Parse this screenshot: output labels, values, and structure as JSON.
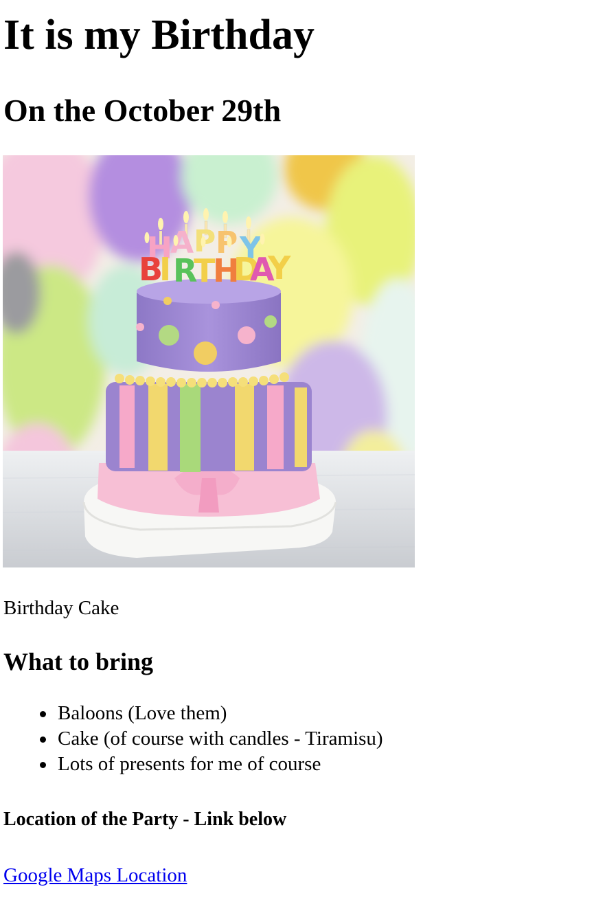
{
  "page": {
    "title": "It is my Birthday",
    "subtitle": "On the October 29th",
    "image": {
      "icon": "birthday-cake-icon",
      "candle_letters_top": [
        "H",
        "A",
        "P",
        "P",
        "Y"
      ],
      "candle_letters_bottom": [
        "B",
        "I",
        "R",
        "T",
        "H",
        "D",
        "A",
        "Y"
      ]
    },
    "caption": "Birthday Cake",
    "bring_heading": "What to bring",
    "bring_items": [
      "Baloons (Love them)",
      "Cake (of course with candles - Tiramisu)",
      "Lots of presents for me of course"
    ],
    "location_heading": "Location of the Party - Link below",
    "maps_link": "Google Maps Location"
  },
  "colors": {
    "link": "#0000ee",
    "text": "#000000",
    "background": "#ffffff"
  }
}
